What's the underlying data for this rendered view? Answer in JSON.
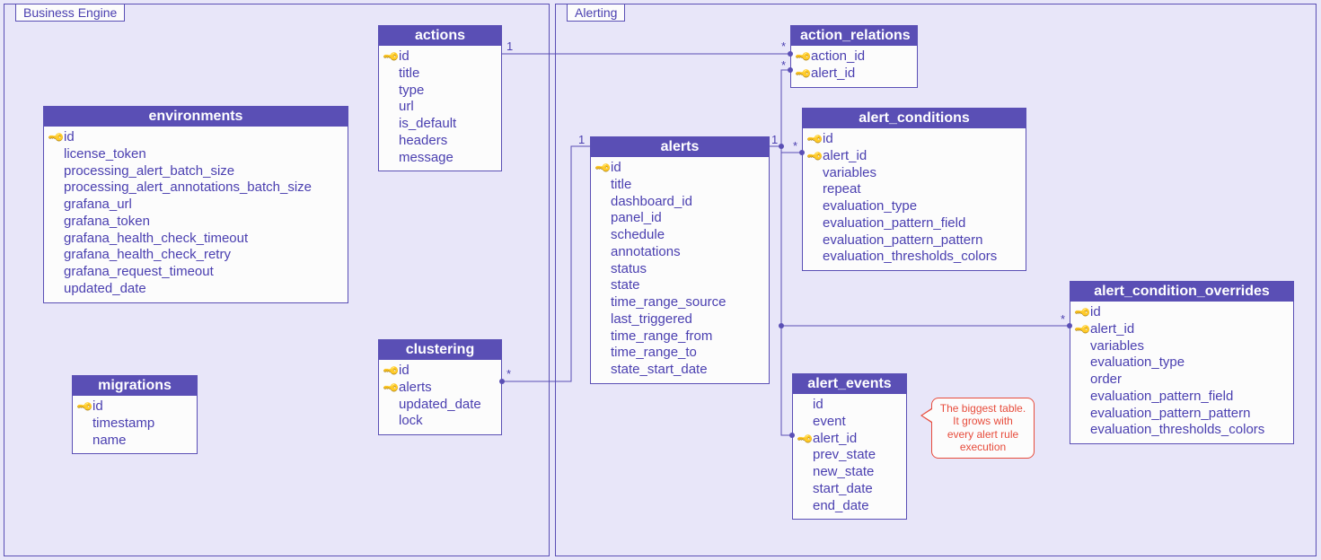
{
  "groups": {
    "business_engine": {
      "label": "Business Engine"
    },
    "alerting": {
      "label": "Alerting"
    }
  },
  "entities": {
    "environments": {
      "title": "environments",
      "fields": [
        {
          "key": true,
          "name": "id"
        },
        {
          "key": false,
          "name": "license_token"
        },
        {
          "key": false,
          "name": "processing_alert_batch_size"
        },
        {
          "key": false,
          "name": "processing_alert_annotations_batch_size"
        },
        {
          "key": false,
          "name": "grafana_url"
        },
        {
          "key": false,
          "name": "grafana_token"
        },
        {
          "key": false,
          "name": "grafana_health_check_timeout"
        },
        {
          "key": false,
          "name": "grafana_health_check_retry"
        },
        {
          "key": false,
          "name": "grafana_request_timeout"
        },
        {
          "key": false,
          "name": "updated_date"
        }
      ]
    },
    "migrations": {
      "title": "migrations",
      "fields": [
        {
          "key": true,
          "name": "id"
        },
        {
          "key": false,
          "name": "timestamp"
        },
        {
          "key": false,
          "name": "name"
        }
      ]
    },
    "actions": {
      "title": "actions",
      "fields": [
        {
          "key": true,
          "name": "id"
        },
        {
          "key": false,
          "name": "title"
        },
        {
          "key": false,
          "name": "type"
        },
        {
          "key": false,
          "name": "url"
        },
        {
          "key": false,
          "name": "is_default"
        },
        {
          "key": false,
          "name": "headers"
        },
        {
          "key": false,
          "name": "message"
        }
      ]
    },
    "clustering": {
      "title": "clustering",
      "fields": [
        {
          "key": true,
          "name": "id"
        },
        {
          "key": true,
          "name": "alerts"
        },
        {
          "key": false,
          "name": "updated_date"
        },
        {
          "key": false,
          "name": "lock"
        }
      ]
    },
    "alerts": {
      "title": "alerts",
      "fields": [
        {
          "key": true,
          "name": "id"
        },
        {
          "key": false,
          "name": "title"
        },
        {
          "key": false,
          "name": "dashboard_id"
        },
        {
          "key": false,
          "name": "panel_id"
        },
        {
          "key": false,
          "name": "schedule"
        },
        {
          "key": false,
          "name": "annotations"
        },
        {
          "key": false,
          "name": "status"
        },
        {
          "key": false,
          "name": "state"
        },
        {
          "key": false,
          "name": "time_range_source"
        },
        {
          "key": false,
          "name": "last_triggered"
        },
        {
          "key": false,
          "name": "time_range_from"
        },
        {
          "key": false,
          "name": "time_range_to"
        },
        {
          "key": false,
          "name": "state_start_date"
        }
      ]
    },
    "action_relations": {
      "title": "action_relations",
      "fields": [
        {
          "key": true,
          "name": "action_id"
        },
        {
          "key": true,
          "name": "alert_id"
        }
      ]
    },
    "alert_conditions": {
      "title": "alert_conditions",
      "fields": [
        {
          "key": true,
          "name": "id"
        },
        {
          "key": true,
          "name": "alert_id"
        },
        {
          "key": false,
          "name": "variables"
        },
        {
          "key": false,
          "name": "repeat"
        },
        {
          "key": false,
          "name": "evaluation_type"
        },
        {
          "key": false,
          "name": "evaluation_pattern_field"
        },
        {
          "key": false,
          "name": "evaluation_pattern_pattern"
        },
        {
          "key": false,
          "name": "evaluation_thresholds_colors"
        }
      ]
    },
    "alert_events": {
      "title": "alert_events",
      "fields": [
        {
          "key": false,
          "name": "id"
        },
        {
          "key": false,
          "name": "event"
        },
        {
          "key": true,
          "name": "alert_id"
        },
        {
          "key": false,
          "name": "prev_state"
        },
        {
          "key": false,
          "name": "new_state"
        },
        {
          "key": false,
          "name": "start_date"
        },
        {
          "key": false,
          "name": "end_date"
        }
      ]
    },
    "alert_condition_overrides": {
      "title": "alert_condition_overrides",
      "fields": [
        {
          "key": true,
          "name": "id"
        },
        {
          "key": true,
          "name": "alert_id"
        },
        {
          "key": false,
          "name": "variables"
        },
        {
          "key": false,
          "name": "evaluation_type"
        },
        {
          "key": false,
          "name": "order"
        },
        {
          "key": false,
          "name": "evaluation_pattern_field"
        },
        {
          "key": false,
          "name": "evaluation_pattern_pattern"
        },
        {
          "key": false,
          "name": "evaluation_thresholds_colors"
        }
      ]
    }
  },
  "note": {
    "line1": "The biggest table.",
    "line2": "It grows with",
    "line3": "every alert rule",
    "line4": "execution"
  },
  "cardinality": {
    "one": "1",
    "many": "*"
  },
  "chart_data": {
    "type": "er-diagram",
    "groups": [
      "Business Engine",
      "Alerting"
    ],
    "entities": [
      {
        "name": "environments",
        "group": "Business Engine"
      },
      {
        "name": "migrations",
        "group": "Business Engine"
      },
      {
        "name": "actions",
        "group": "Business Engine"
      },
      {
        "name": "clustering",
        "group": "Business Engine"
      },
      {
        "name": "alerts",
        "group": "Alerting"
      },
      {
        "name": "action_relations",
        "group": "Alerting"
      },
      {
        "name": "alert_conditions",
        "group": "Alerting"
      },
      {
        "name": "alert_events",
        "group": "Alerting"
      },
      {
        "name": "alert_condition_overrides",
        "group": "Alerting"
      }
    ],
    "relationships": [
      {
        "from": "actions",
        "from_card": "1",
        "to": "action_relations",
        "to_card": "*",
        "via": "action_id"
      },
      {
        "from": "alerts",
        "from_card": "1",
        "to": "action_relations",
        "to_card": "*",
        "via": "alert_id"
      },
      {
        "from": "alerts",
        "from_card": "1",
        "to": "alert_conditions",
        "to_card": "*",
        "via": "alert_id"
      },
      {
        "from": "alerts",
        "from_card": "1",
        "to": "alert_condition_overrides",
        "to_card": "*",
        "via": "alert_id"
      },
      {
        "from": "alerts",
        "from_card": "1",
        "to": "alert_events",
        "to_card": "*",
        "via": "alert_id"
      },
      {
        "from": "alerts",
        "from_card": "1",
        "to": "clustering",
        "to_card": "*",
        "via": "alerts"
      }
    ],
    "annotations": [
      {
        "target": "alert_events",
        "text": "The biggest table. It grows with every alert rule execution"
      }
    ]
  }
}
